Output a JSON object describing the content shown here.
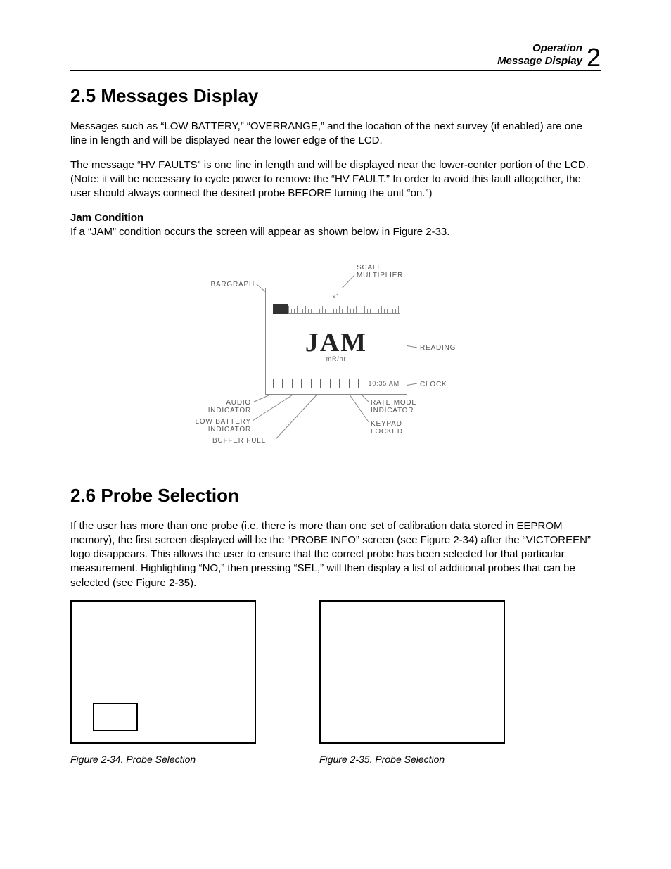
{
  "header": {
    "line1": "Operation",
    "line2": "Message Display",
    "chapter_number": "2"
  },
  "section1": {
    "heading": "2.5 Messages Display",
    "p1": "Messages such as “LOW BATTERY,” “OVERRANGE,” and the location of the next survey (if enabled) are one line in length and will be displayed near the lower edge of the LCD.",
    "p2": "The message “HV FAULTS” is one line in length and will be displayed near the lower-center portion of the LCD. (Note: it will be necessary to cycle power to remove the “HV FAULT.” In order to avoid this fault altogether, the user should always connect the desired probe BEFORE turning the unit “on.”)",
    "subhead": "Jam Condition",
    "p3": "If a “JAM” condition occurs the screen will appear as shown below in Figure 2-33."
  },
  "diagram": {
    "scale_x": "x1",
    "main_text": "JAM",
    "units": "mR/hr",
    "time": "10:35 AM",
    "callouts": {
      "bargraph": "BARGRAPH",
      "scale_multiplier_l1": "SCALE",
      "scale_multiplier_l2": "MULTIPLIER",
      "reading": "READING",
      "clock": "CLOCK",
      "rate_mode_l1": "RATE MODE",
      "rate_mode_l2": "INDICATOR",
      "keypad_l1": "KEYPAD",
      "keypad_l2": "LOCKED",
      "audio_l1": "AUDIO",
      "audio_l2": "INDICATOR",
      "low_batt_l1": "LOW BATTERY",
      "low_batt_l2": "INDICATOR",
      "buffer_full": "BUFFER FULL"
    }
  },
  "section2": {
    "heading": "2.6 Probe Selection",
    "p1": "If the user has more than one probe (i.e. there is more than one set of calibration data stored in EEPROM memory), the first screen displayed will be the “PROBE INFO” screen (see Figure 2-34) after the “VICTOREEN” logo disappears. This allows the user to ensure that the correct probe has been selected for that particular measurement.  Highlighting “NO,” then pressing “SEL,” will then display a list of additional probes that can be selected (see Figure 2-35)."
  },
  "figures": {
    "cap34": "Figure 2-34. Probe Selection",
    "cap35": "Figure 2-35.  Probe Selection"
  }
}
